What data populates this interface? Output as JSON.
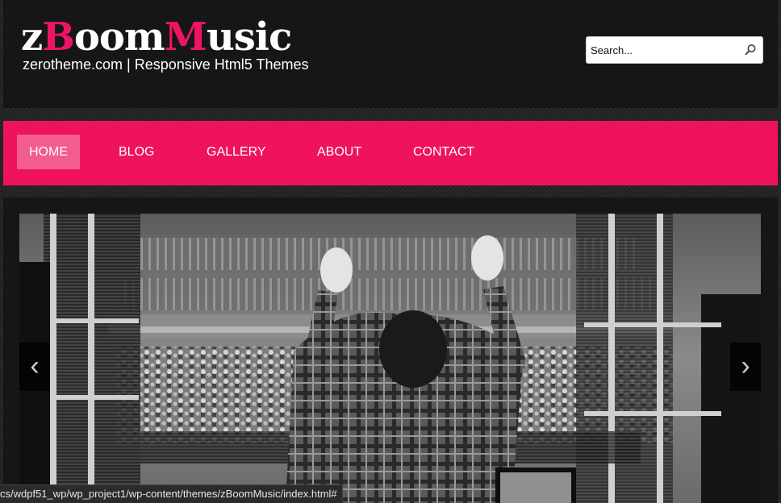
{
  "header": {
    "logo": {
      "part1": "z",
      "part2": "B",
      "part3": "oom",
      "part4": "M",
      "part5": "usic"
    },
    "tagline": "zerotheme.com | Responsive Html5 Themes",
    "search": {
      "placeholder": "Search..."
    }
  },
  "nav": {
    "items": [
      {
        "label": "HOME"
      },
      {
        "label": "BLOG"
      },
      {
        "label": "GALLERY"
      },
      {
        "label": "ABOUT"
      },
      {
        "label": "CONTACT"
      }
    ]
  },
  "slider": {
    "prev_label": "‹",
    "next_label": "›"
  },
  "statusbar": {
    "url": "cs/wdpf51_wp/wp_project1/wp-content/themes/zBoomMusic/index.html#"
  },
  "colors": {
    "accent": "#ef135f",
    "nav_active": "#f25c8e",
    "header_bg": "#161616"
  }
}
